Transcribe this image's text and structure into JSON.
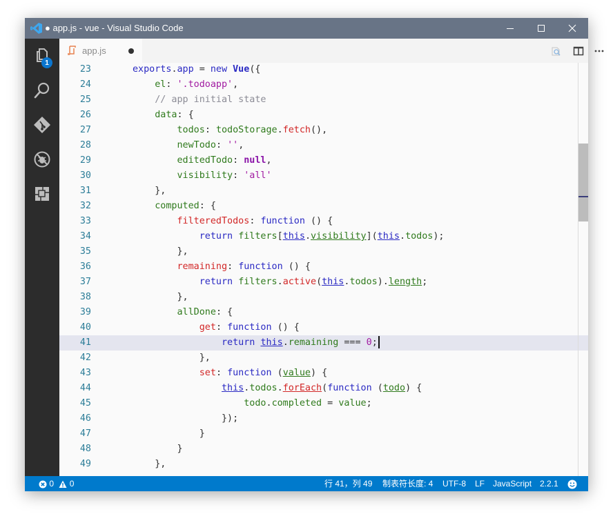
{
  "window": {
    "title": "● app.js - vue - Visual Studio Code",
    "controls": {
      "minimize": "minimize-icon",
      "maximize": "maximize-icon",
      "close": "close-icon"
    }
  },
  "activitybar": {
    "items": [
      {
        "name": "explorer",
        "icon": "files-icon",
        "badge": "1"
      },
      {
        "name": "search",
        "icon": "search-icon"
      },
      {
        "name": "git",
        "icon": "git-icon"
      },
      {
        "name": "debug",
        "icon": "debug-icon"
      },
      {
        "name": "extensions",
        "icon": "extensions-icon"
      }
    ]
  },
  "tabs": [
    {
      "label": "app.js",
      "icon": "javascript-file-icon",
      "dirty": true
    }
  ],
  "tab_actions": [
    "open-preview-icon",
    "split-editor-icon",
    "more-icon"
  ],
  "editor": {
    "current_line": 41,
    "lines": [
      23,
      24,
      25,
      26,
      27,
      28,
      29,
      30,
      31,
      32,
      33,
      34,
      35,
      36,
      37,
      38,
      39,
      40,
      41,
      42,
      43,
      44,
      45,
      46,
      47,
      48,
      49
    ],
    "code_text": [
      "exports.app = new Vue({",
      "    el: '.todoapp',",
      "    // app initial state",
      "    data: {",
      "        todos: todoStorage.fetch(),",
      "        newTodo: '',",
      "        editedTodo: null,",
      "        visibility: 'all'",
      "    },",
      "    computed: {",
      "        filteredTodos: function () {",
      "            return filters[this.visibility](this.todos);",
      "        },",
      "        remaining: function () {",
      "            return filters.active(this.todos).length;",
      "        },",
      "        allDone: {",
      "            get: function () {",
      "                return this.remaining === 0;",
      "            },",
      "            set: function (value) {",
      "                this.todos.forEach(function (todo) {",
      "                    todo.completed = value;",
      "                });",
      "            }",
      "        }",
      "    },"
    ]
  },
  "statusbar": {
    "errors": "0",
    "warnings": "0",
    "position": "行 41，列 49",
    "tab_size": "制表符长度: 4",
    "encoding": "UTF-8",
    "eol": "LF",
    "language": "JavaScript",
    "version": "2.2.1",
    "feedback_icon": "smiley-icon"
  },
  "colors": {
    "titlebar": "#687486",
    "activitybar": "#2c2c2c",
    "statusbar": "#007acc",
    "badge": "#0b76cf",
    "current_line": "#e4e5ef"
  }
}
